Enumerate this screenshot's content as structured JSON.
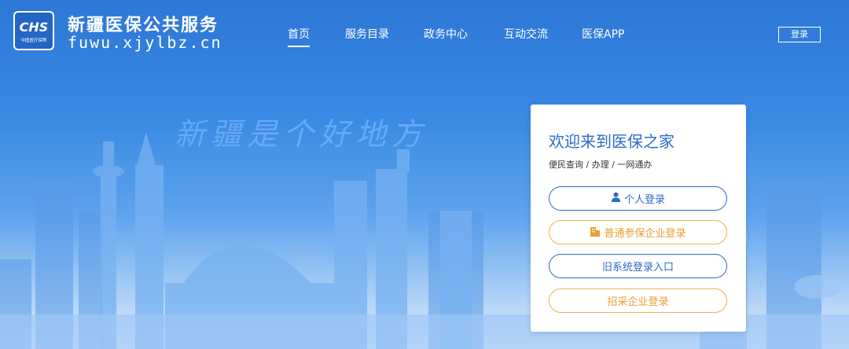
{
  "brand": {
    "logo_text": "CHS",
    "logo_subtext": "中国医疗保障",
    "title": "新疆医保公共服务",
    "domain": "fuwu.xjylbz.cn"
  },
  "nav": {
    "items": [
      {
        "label": "首页",
        "active": true
      },
      {
        "label": "服务目录"
      },
      {
        "label": "政务中心"
      },
      {
        "label": "互动交流"
      },
      {
        "label": "医保APP"
      }
    ],
    "login_label": "登录"
  },
  "banner": {
    "slogan": "新疆是个好地方"
  },
  "card": {
    "title": "欢迎来到医保之家",
    "subtitle": "便民查询 / 办理 / 一网通办",
    "buttons": [
      {
        "label": "个人登录",
        "icon": "person-icon",
        "color": "#2a6bc7"
      },
      {
        "label": "普通参保企业登录",
        "icon": "building-icon",
        "color": "#e7a033"
      },
      {
        "label": "旧系统登录入口",
        "color": "#2a6bc7"
      },
      {
        "label": "招采企业登录",
        "color": "#e7a033"
      }
    ]
  }
}
